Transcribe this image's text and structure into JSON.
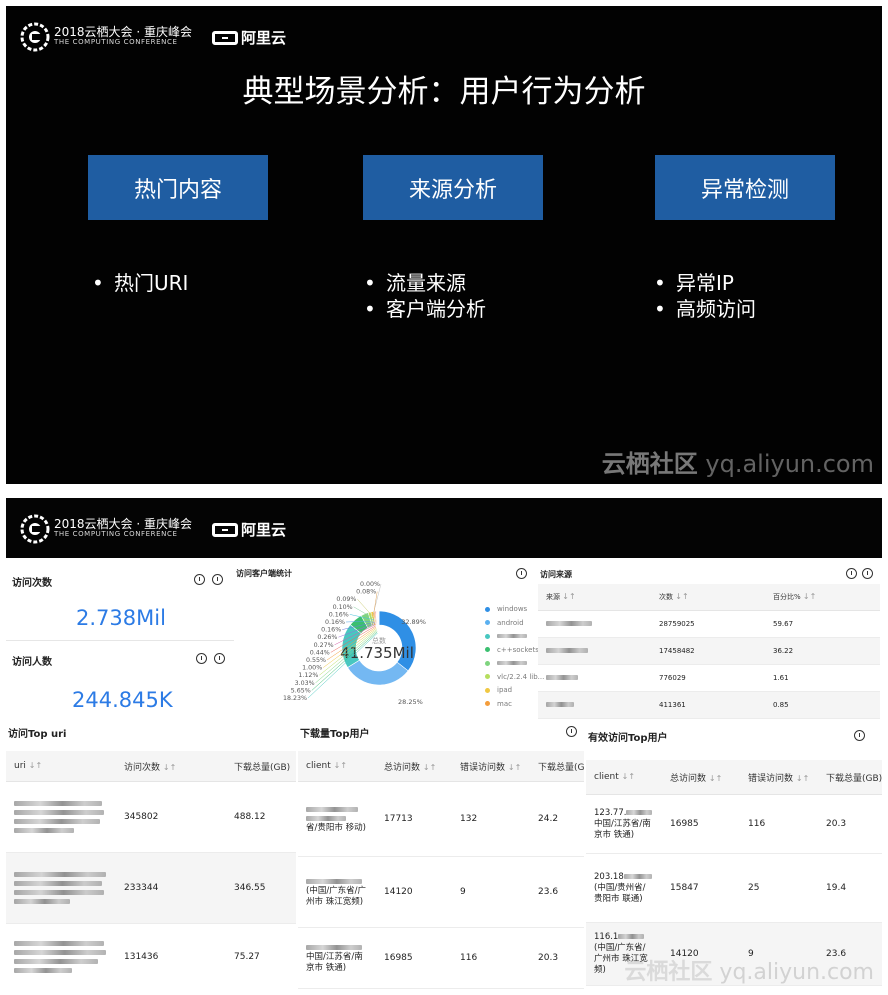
{
  "conference": {
    "name": "2018云栖大会 · 重庆峰会",
    "sub": "THE COMPUTING CONFERENCE",
    "brand": "阿里云"
  },
  "watermark": {
    "cn": "云栖社区",
    "en": "yq.aliyun.com"
  },
  "slide1": {
    "title": "典型场景分析：用户行为分析",
    "columns": [
      {
        "label": "热门内容",
        "bullets": [
          "热门URI"
        ]
      },
      {
        "label": "来源分析",
        "bullets": [
          "流量来源",
          "客户端分析"
        ]
      },
      {
        "label": "异常检测",
        "bullets": [
          "异常IP",
          "高频访问"
        ]
      }
    ]
  },
  "dashboard": {
    "visits": {
      "title": "访问次数",
      "value": "2.738Mil"
    },
    "visitors": {
      "title": "访问人数",
      "value": "244.845K"
    },
    "client_stats": {
      "title": "访问客户端统计",
      "center_label": "总数",
      "center_value": "41.735Mil",
      "small_labels": [
        "0.00%",
        "0.08%",
        "0.09%",
        "0.10%",
        "0.16%",
        "0.16%",
        "0.16%",
        "0.26%",
        "0.27%",
        "0.44%",
        "0.55%",
        "1.00%",
        "1.12%",
        "3.03%",
        "5.65%",
        "18.23%"
      ],
      "big_labels": [
        "32.89%",
        "28.25%"
      ],
      "legend": [
        {
          "label": "windows",
          "color": "#2f8fe5"
        },
        {
          "label": "android",
          "color": "#5ab0f0"
        },
        {
          "label": "",
          "color": "#48c7c0"
        },
        {
          "label": "c++sockets/",
          "color": "#3bbf70"
        },
        {
          "label": "",
          "color": "#7fd47f"
        },
        {
          "label": "vlc/2.2.4 lib...",
          "color": "#b6de5e"
        },
        {
          "label": "ipad",
          "color": "#f0c843"
        },
        {
          "label": "mac",
          "color": "#f49d3c"
        }
      ]
    },
    "sources": {
      "title": "访问来源",
      "headers": [
        "来源",
        "次数",
        "百分比%"
      ],
      "rows": [
        {
          "count": "28759025",
          "pct": "59.67"
        },
        {
          "count": "17458482",
          "pct": "36.22"
        },
        {
          "count": "776029",
          "pct": "1.61"
        },
        {
          "count": "411361",
          "pct": "0.85"
        }
      ]
    },
    "top_uri": {
      "title": "访问Top uri",
      "headers": [
        "uri",
        "访问次数",
        "下载总量(GB)"
      ],
      "rows": [
        {
          "visits": "345802",
          "gb": "488.12"
        },
        {
          "visits": "233344",
          "gb": "346.55"
        },
        {
          "visits": "131436",
          "gb": "75.27"
        }
      ]
    },
    "top_download": {
      "title": "下载量Top用户",
      "headers": [
        "client",
        "总访问数",
        "错误访问数",
        "下载总量(G"
      ],
      "rows": [
        {
          "client": "省/贵阳市 移动)",
          "total": "17713",
          "errors": "132",
          "gb": "24.2"
        },
        {
          "client": "(中国/广东省/广州市 珠江宽频)",
          "total": "14120",
          "errors": "9",
          "gb": "23.6"
        },
        {
          "client": "中国/江苏省/南京市 铁通)",
          "total": "16985",
          "errors": "116",
          "gb": "20.3"
        }
      ]
    },
    "top_valid": {
      "title": "有效访问Top用户",
      "headers": [
        "client",
        "总访问数",
        "错误访问数",
        "下载总量(GB)"
      ],
      "rows": [
        {
          "ip": "123.77.",
          "client": "中国/江苏省/南京市 铁通)",
          "total": "16985",
          "errors": "116",
          "gb": "20.3"
        },
        {
          "ip": "203.18",
          "client": "(中国/贵州省/贵阳市 联通)",
          "total": "15847",
          "errors": "25",
          "gb": "19.4"
        },
        {
          "ip": "116.1",
          "client": "(中国/广东省/广州市 珠江宽频)",
          "total": "14120",
          "errors": "9",
          "gb": "23.6"
        }
      ]
    }
  }
}
